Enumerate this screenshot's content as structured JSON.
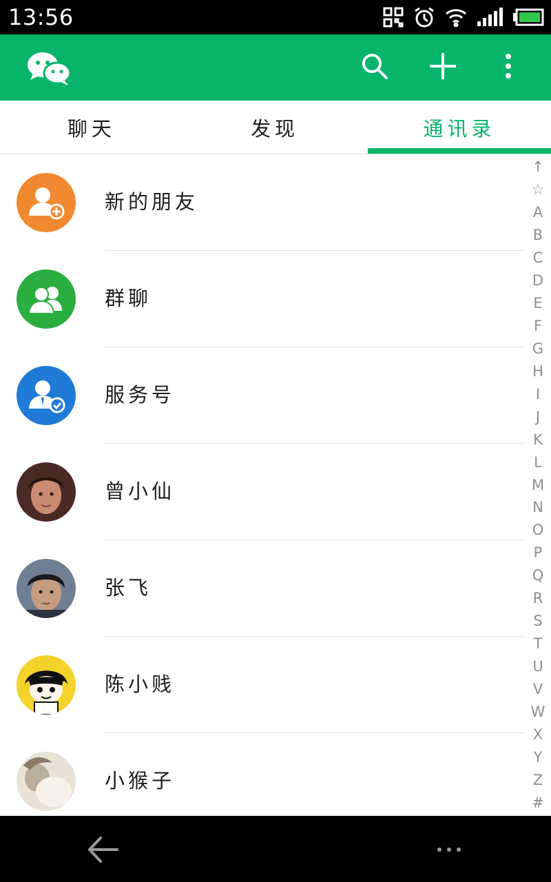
{
  "status_bar": {
    "time": "13:56",
    "icons": [
      "qr-scan-icon",
      "alarm-icon",
      "wifi-icon",
      "signal-icon",
      "battery-icon"
    ]
  },
  "app_bar": {
    "logo": "wechat-logo-icon",
    "actions": [
      "search-icon",
      "plus-icon",
      "overflow-menu-icon"
    ],
    "color": "#07b56a"
  },
  "tabs": [
    {
      "label": "聊天",
      "active": false
    },
    {
      "label": "发现",
      "active": false
    },
    {
      "label": "通讯录",
      "active": true
    }
  ],
  "contacts": [
    {
      "name": "新的朋友",
      "avatar": "new-friend-icon",
      "avatar_color": "#f0892f"
    },
    {
      "name": "群聊",
      "avatar": "group-chat-icon",
      "avatar_color": "#2aae3f"
    },
    {
      "name": "服务号",
      "avatar": "service-account-icon",
      "avatar_color": "#1f7bd6"
    },
    {
      "name": "曾小仙",
      "avatar": "photo-avatar"
    },
    {
      "name": "张飞",
      "avatar": "photo-avatar"
    },
    {
      "name": "陈小贱",
      "avatar": "cartoon-avatar"
    },
    {
      "name": "小猴子",
      "avatar": "photo-avatar"
    }
  ],
  "index_bar": [
    "↑",
    "☆",
    "A",
    "B",
    "C",
    "D",
    "E",
    "F",
    "G",
    "H",
    "I",
    "J",
    "K",
    "L",
    "M",
    "N",
    "O",
    "P",
    "Q",
    "R",
    "S",
    "T",
    "U",
    "V",
    "W",
    "X",
    "Y",
    "Z",
    "#"
  ],
  "nav_bar": {
    "icons": [
      "back-arrow-icon",
      "menu-dots-icon"
    ]
  }
}
